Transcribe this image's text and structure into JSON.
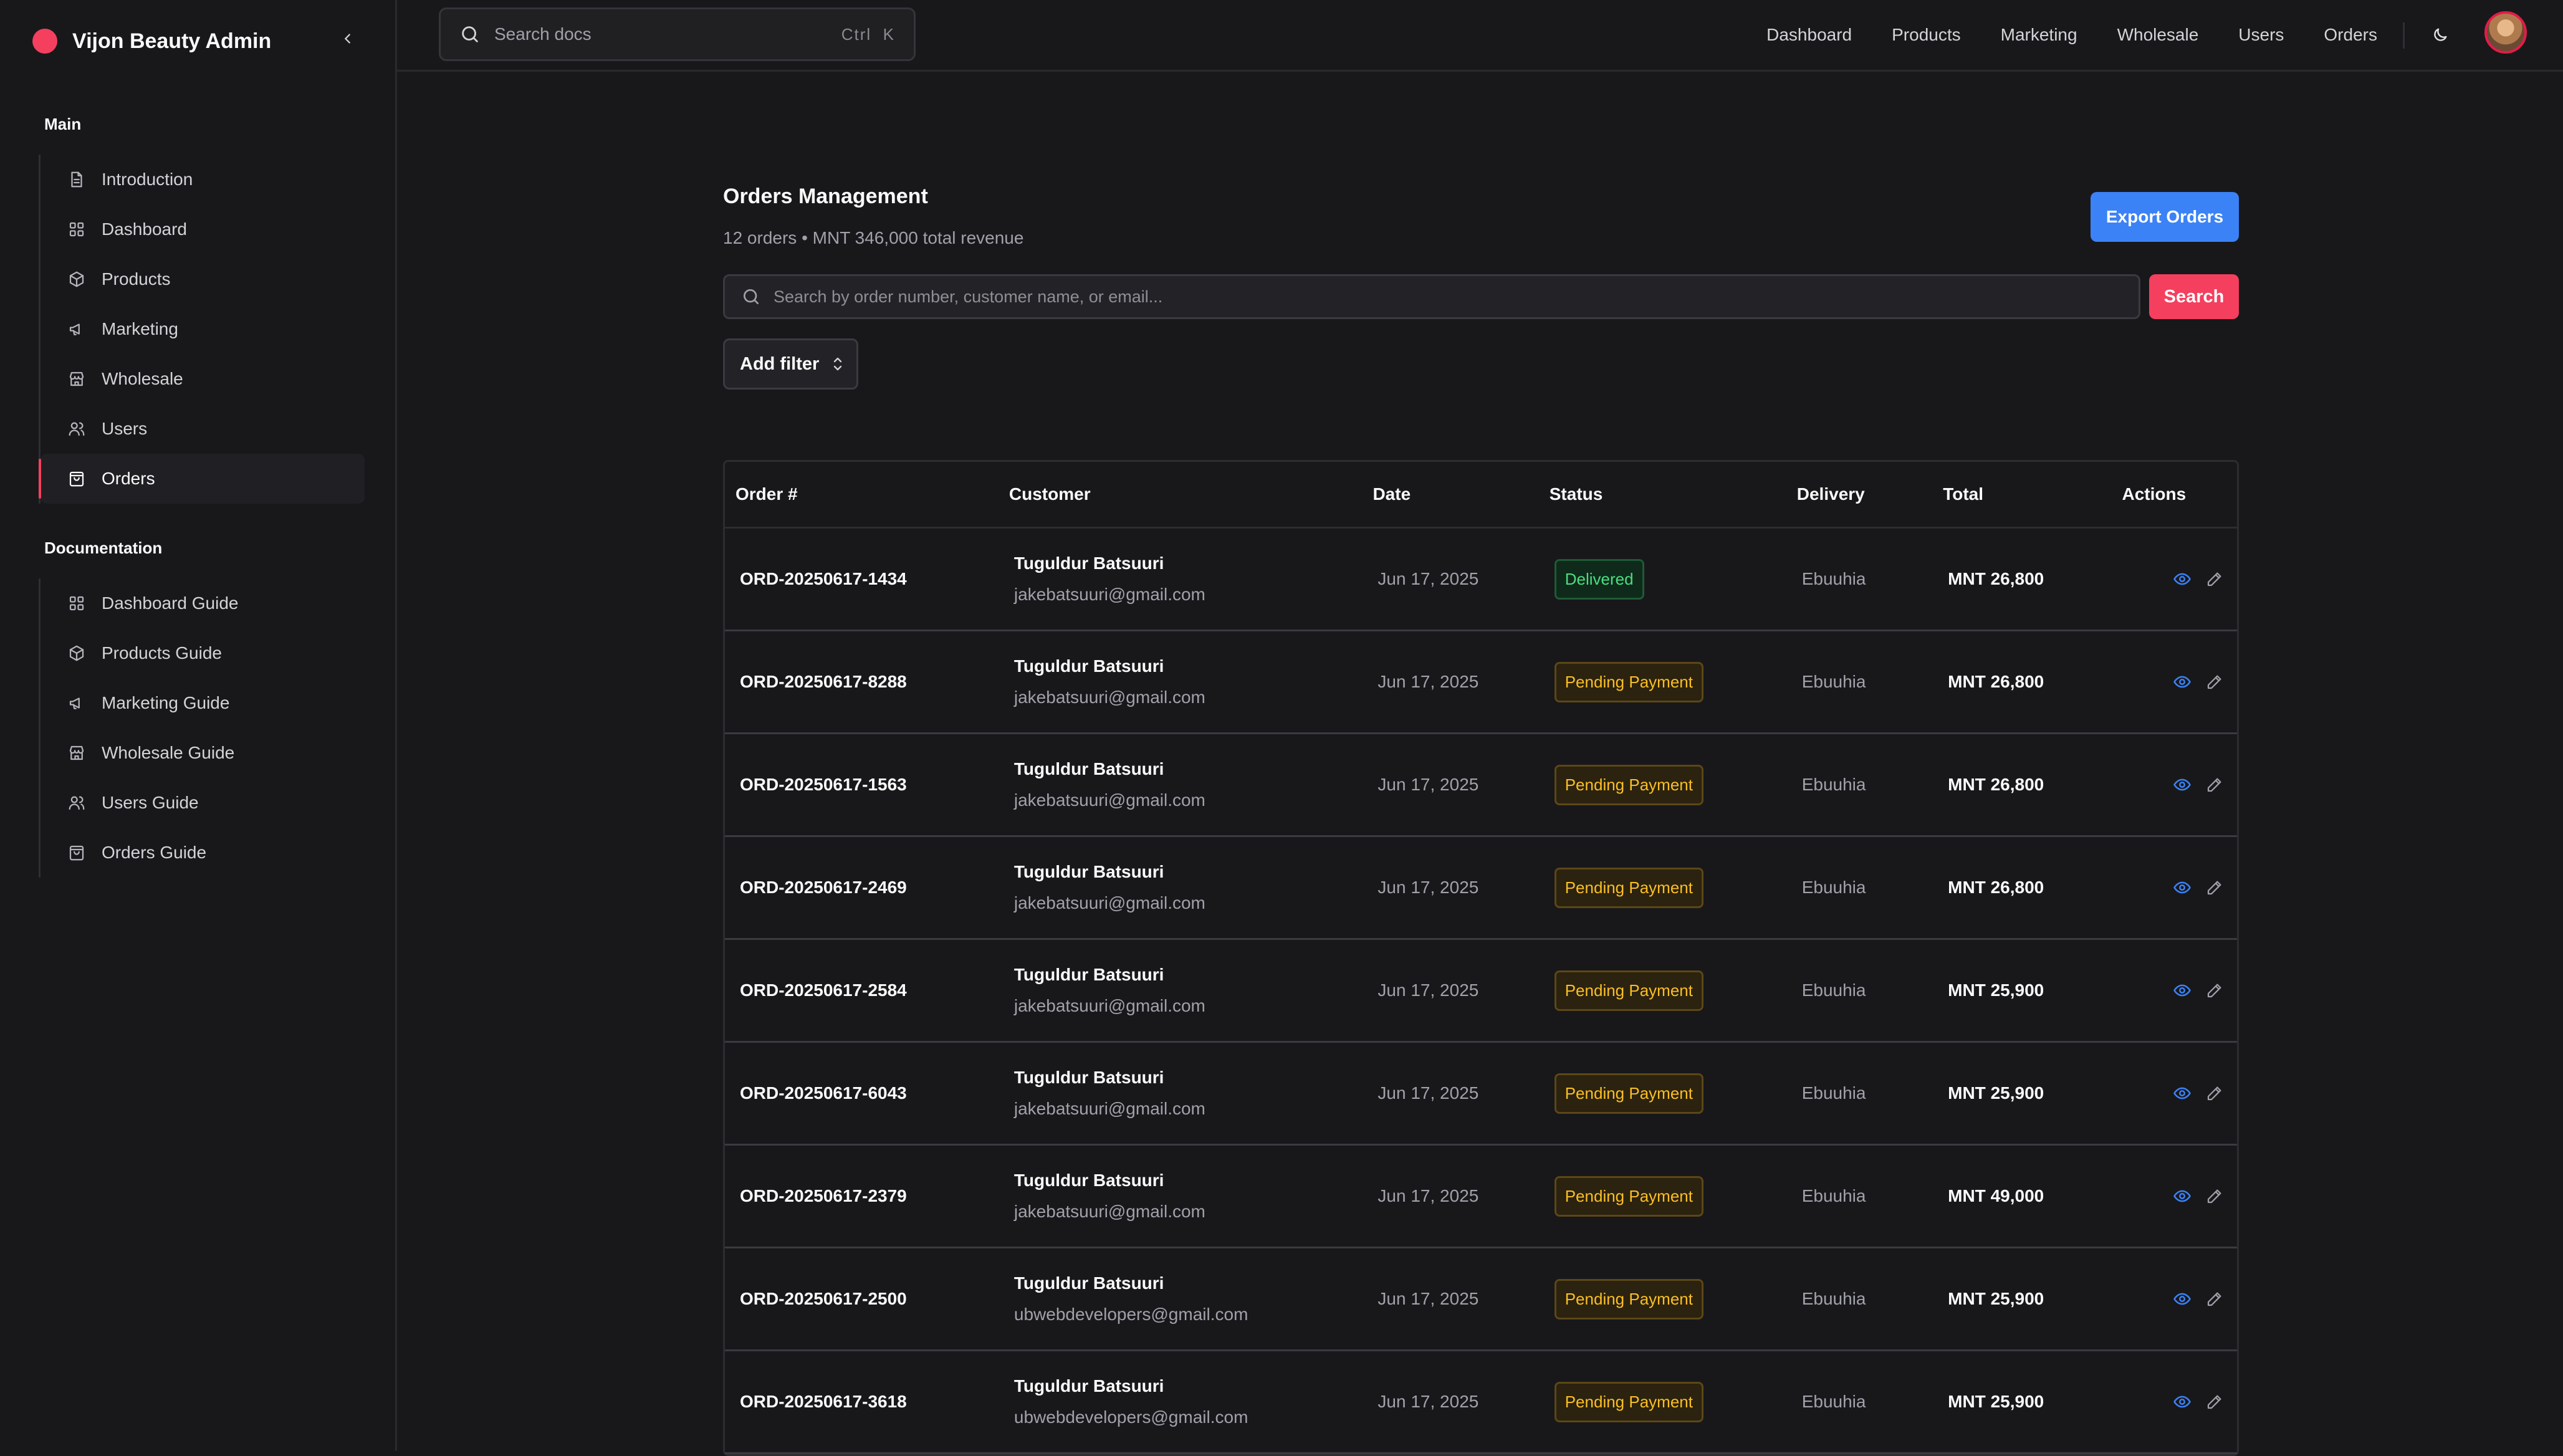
{
  "app": {
    "title": "Vijon Beauty Admin",
    "brand_color": "#f43f5e"
  },
  "sidebar": {
    "main_label": "Main",
    "main_items": [
      {
        "label": "Introduction",
        "icon": "file-icon"
      },
      {
        "label": "Dashboard",
        "icon": "grid-icon"
      },
      {
        "label": "Products",
        "icon": "box-icon"
      },
      {
        "label": "Marketing",
        "icon": "megaphone-icon"
      },
      {
        "label": "Wholesale",
        "icon": "store-icon"
      },
      {
        "label": "Users",
        "icon": "users-icon"
      },
      {
        "label": "Orders",
        "icon": "shopping-bag-icon",
        "active": true
      }
    ],
    "docs_label": "Documentation",
    "docs_items": [
      {
        "label": "Dashboard Guide",
        "icon": "grid-icon"
      },
      {
        "label": "Products Guide",
        "icon": "box-icon"
      },
      {
        "label": "Marketing Guide",
        "icon": "megaphone-icon"
      },
      {
        "label": "Wholesale Guide",
        "icon": "store-icon"
      },
      {
        "label": "Users Guide",
        "icon": "users-icon"
      },
      {
        "label": "Orders Guide",
        "icon": "shopping-bag-icon"
      }
    ]
  },
  "topbar": {
    "search_placeholder": "Search docs",
    "shortcut": "Ctrl  K",
    "nav": [
      "Dashboard",
      "Products",
      "Marketing",
      "Wholesale",
      "Users",
      "Orders"
    ]
  },
  "main": {
    "title": "Orders Management",
    "subtitle": "12 orders • MNT 346,000 total revenue",
    "export_label": "Export Orders",
    "search_placeholder": "Search by order number, customer name, or email...",
    "search_button": "Search",
    "filter_label": "Add filter",
    "accent_blue": "#3b82f6"
  },
  "table": {
    "headers": [
      "Order #",
      "Customer",
      "Date",
      "Status",
      "Delivery",
      "Total",
      "Actions"
    ],
    "rows": [
      {
        "order": "ORD-20250617-1434",
        "name": "Tuguldur Batsuuri",
        "email": "jakebatsuuri@gmail.com",
        "date": "Jun 17, 2025",
        "status": "Delivered",
        "status_type": "delivered",
        "delivery": "Ebuuhia",
        "total": "MNT 26,800"
      },
      {
        "order": "ORD-20250617-8288",
        "name": "Tuguldur Batsuuri",
        "email": "jakebatsuuri@gmail.com",
        "date": "Jun 17, 2025",
        "status": "Pending Payment",
        "status_type": "pending",
        "delivery": "Ebuuhia",
        "total": "MNT 26,800"
      },
      {
        "order": "ORD-20250617-1563",
        "name": "Tuguldur Batsuuri",
        "email": "jakebatsuuri@gmail.com",
        "date": "Jun 17, 2025",
        "status": "Pending Payment",
        "status_type": "pending",
        "delivery": "Ebuuhia",
        "total": "MNT 26,800"
      },
      {
        "order": "ORD-20250617-2469",
        "name": "Tuguldur Batsuuri",
        "email": "jakebatsuuri@gmail.com",
        "date": "Jun 17, 2025",
        "status": "Pending Payment",
        "status_type": "pending",
        "delivery": "Ebuuhia",
        "total": "MNT 26,800"
      },
      {
        "order": "ORD-20250617-2584",
        "name": "Tuguldur Batsuuri",
        "email": "jakebatsuuri@gmail.com",
        "date": "Jun 17, 2025",
        "status": "Pending Payment",
        "status_type": "pending",
        "delivery": "Ebuuhia",
        "total": "MNT 25,900"
      },
      {
        "order": "ORD-20250617-6043",
        "name": "Tuguldur Batsuuri",
        "email": "jakebatsuuri@gmail.com",
        "date": "Jun 17, 2025",
        "status": "Pending Payment",
        "status_type": "pending",
        "delivery": "Ebuuhia",
        "total": "MNT 25,900"
      },
      {
        "order": "ORD-20250617-2379",
        "name": "Tuguldur Batsuuri",
        "email": "jakebatsuuri@gmail.com",
        "date": "Jun 17, 2025",
        "status": "Pending Payment",
        "status_type": "pending",
        "delivery": "Ebuuhia",
        "total": "MNT 49,000"
      },
      {
        "order": "ORD-20250617-2500",
        "name": "Tuguldur Batsuuri",
        "email": "ubwebdevelopers@gmail.com",
        "date": "Jun 17, 2025",
        "status": "Pending Payment",
        "status_type": "pending",
        "delivery": "Ebuuhia",
        "total": "MNT 25,900"
      },
      {
        "order": "ORD-20250617-3618",
        "name": "Tuguldur Batsuuri",
        "email": "ubwebdevelopers@gmail.com",
        "date": "Jun 17, 2025",
        "status": "Pending Payment",
        "status_type": "pending",
        "delivery": "Ebuuhia",
        "total": "MNT 25,900"
      }
    ]
  }
}
